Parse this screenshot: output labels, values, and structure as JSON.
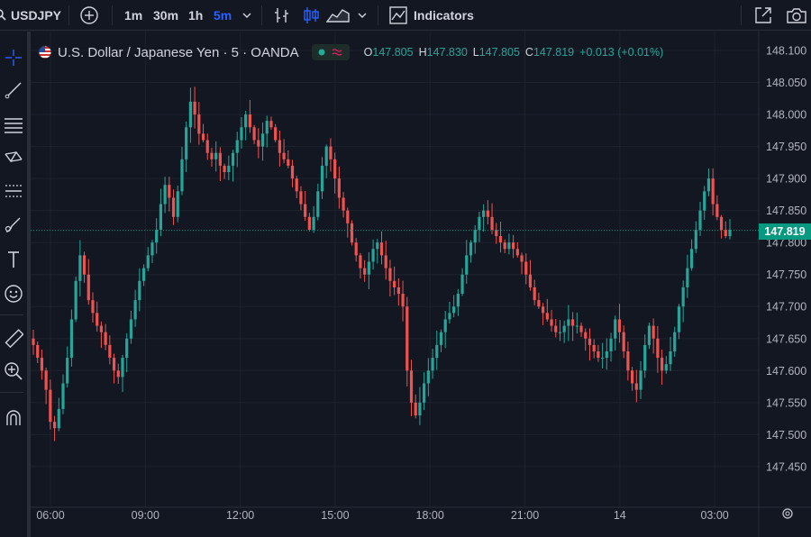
{
  "toolbar": {
    "symbol": "USDJPY",
    "intervals": [
      "1m",
      "30m",
      "1h",
      "5m"
    ],
    "indicators_label": "Indicators"
  },
  "legend": {
    "title": "U.S. Dollar / Japanese Yen · 5 · OANDA",
    "open_label": "O",
    "open": "147.805",
    "high_label": "H",
    "high": "147.830",
    "low_label": "L",
    "low": "147.805",
    "close_label": "C",
    "close": "147.819",
    "change": "+0.013 (+0.01%)"
  },
  "price_axis": {
    "labels": [
      "148.100",
      "148.050",
      "148.000",
      "147.950",
      "147.900",
      "147.850",
      "147.800",
      "147.750",
      "147.700",
      "147.650",
      "147.600",
      "147.550",
      "147.500",
      "147.450"
    ],
    "current_price": "147.819"
  },
  "time_axis": {
    "labels": [
      "06:00",
      "09:00",
      "12:00",
      "15:00",
      "18:00",
      "21:00",
      "14",
      "03:00"
    ]
  },
  "colors": {
    "background": "#131722",
    "up": "#26a69a",
    "down": "#ef5350",
    "grid": "#1e222d",
    "current_price": "#089981",
    "active_interval": "#2962ff"
  },
  "chart_data": {
    "type": "candlestick",
    "symbol": "USDJPY",
    "interval": "5",
    "ylim": [
      147.43,
      148.12
    ],
    "grid": true,
    "close_series": [
      147.64,
      147.62,
      147.6,
      147.57,
      147.52,
      147.51,
      147.54,
      147.58,
      147.62,
      147.68,
      147.74,
      147.78,
      147.75,
      147.71,
      147.69,
      147.67,
      147.66,
      147.64,
      147.62,
      147.6,
      147.59,
      147.62,
      147.65,
      147.68,
      147.71,
      147.74,
      147.76,
      147.78,
      147.8,
      147.82,
      147.86,
      147.89,
      147.87,
      147.84,
      147.88,
      147.93,
      147.98,
      148.02,
      148.0,
      147.97,
      147.96,
      147.94,
      147.93,
      147.94,
      147.92,
      147.91,
      147.92,
      147.94,
      147.96,
      147.98,
      148.0,
      147.98,
      147.96,
      147.95,
      147.97,
      147.99,
      147.98,
      147.96,
      147.94,
      147.93,
      147.92,
      147.9,
      147.88,
      147.86,
      147.84,
      147.82,
      147.84,
      147.88,
      147.92,
      147.95,
      147.93,
      147.9,
      147.87,
      147.85,
      147.83,
      147.8,
      147.78,
      147.76,
      147.75,
      147.77,
      147.79,
      147.8,
      147.78,
      147.76,
      147.74,
      147.73,
      147.72,
      147.7,
      147.6,
      147.55,
      147.53,
      147.55,
      147.58,
      147.6,
      147.62,
      147.64,
      147.66,
      147.68,
      147.69,
      147.7,
      147.72,
      147.75,
      147.78,
      147.8,
      147.82,
      147.84,
      147.85,
      147.84,
      147.82,
      147.81,
      147.8,
      147.79,
      147.8,
      147.79,
      147.78,
      147.77,
      147.75,
      147.73,
      147.71,
      147.7,
      147.69,
      147.68,
      147.67,
      147.66,
      147.66,
      147.67,
      147.68,
      147.67,
      147.67,
      147.66,
      147.65,
      147.64,
      147.63,
      147.62,
      147.62,
      147.63,
      147.65,
      147.68,
      147.66,
      147.63,
      147.6,
      147.58,
      147.57,
      147.6,
      147.64,
      147.67,
      147.65,
      147.62,
      147.6,
      147.61,
      147.63,
      147.66,
      147.7,
      147.73,
      147.76,
      147.79,
      147.82,
      147.85,
      147.88,
      147.9,
      147.86,
      147.84,
      147.82,
      147.81,
      147.82
    ]
  }
}
